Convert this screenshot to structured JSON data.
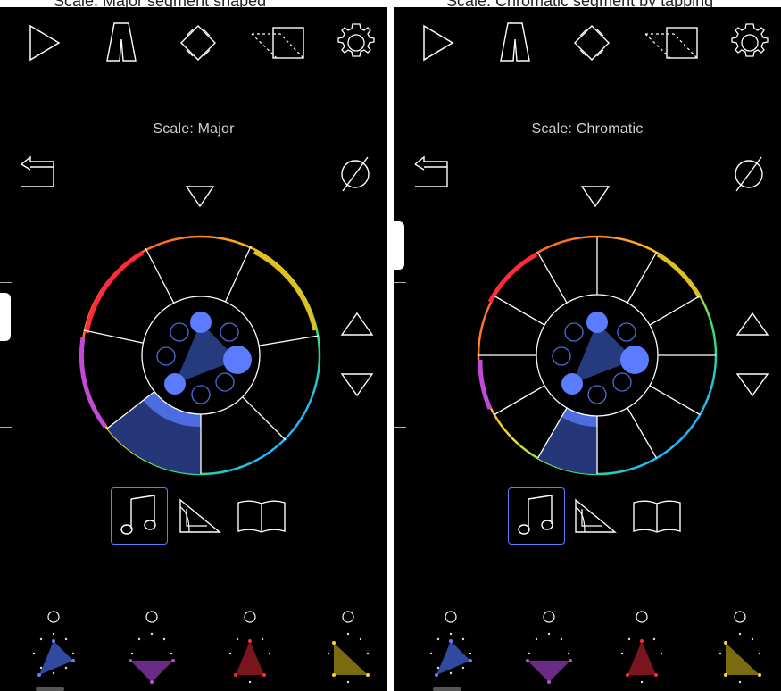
{
  "caption": {
    "left_text": "Scale: Major segment shaped",
    "right_text": "Scale: Chromatic segment by tapping"
  },
  "screens": [
    {
      "id": "left",
      "scale_label": "Scale: Major",
      "toolbar": [
        "play-icon",
        "tuning-fork-icon",
        "diamond-icon",
        "perspective-square-icon",
        "gear-icon"
      ],
      "segments": 7,
      "selected_segment": 5,
      "mode_buttons": [
        "music-notes-icon",
        "triangle-ruler-icon",
        "book-icon"
      ],
      "active_mode": "music-notes-icon",
      "presets": [
        {
          "color": "#2f4a9e",
          "vertex": "#6b7cff"
        },
        {
          "color": "#6a2a86",
          "vertex": "#c24ad6"
        },
        {
          "color": "#7a1620",
          "vertex": "#ff2a3a"
        },
        {
          "color": "#7a6a10",
          "vertex": "#ffd62a"
        }
      ]
    },
    {
      "id": "right",
      "scale_label": "Scale: Chromatic",
      "toolbar": [
        "play-icon",
        "tuning-fork-icon",
        "diamond-icon",
        "perspective-square-icon",
        "gear-icon"
      ],
      "segments": 12,
      "selected_segment": 7,
      "mode_buttons": [
        "music-notes-icon",
        "triangle-ruler-icon",
        "book-icon"
      ],
      "active_mode": "music-notes-icon",
      "presets": [
        {
          "color": "#2f4a9e",
          "vertex": "#6b7cff"
        },
        {
          "color": "#6a2a86",
          "vertex": "#c24ad6"
        },
        {
          "color": "#7a1620",
          "vertex": "#ff2a3a"
        },
        {
          "color": "#7a6a10",
          "vertex": "#ffd62a"
        }
      ]
    }
  ],
  "colors": {
    "accent": "#5b7cff",
    "background": "#000000",
    "stroke": "#ffffff"
  }
}
